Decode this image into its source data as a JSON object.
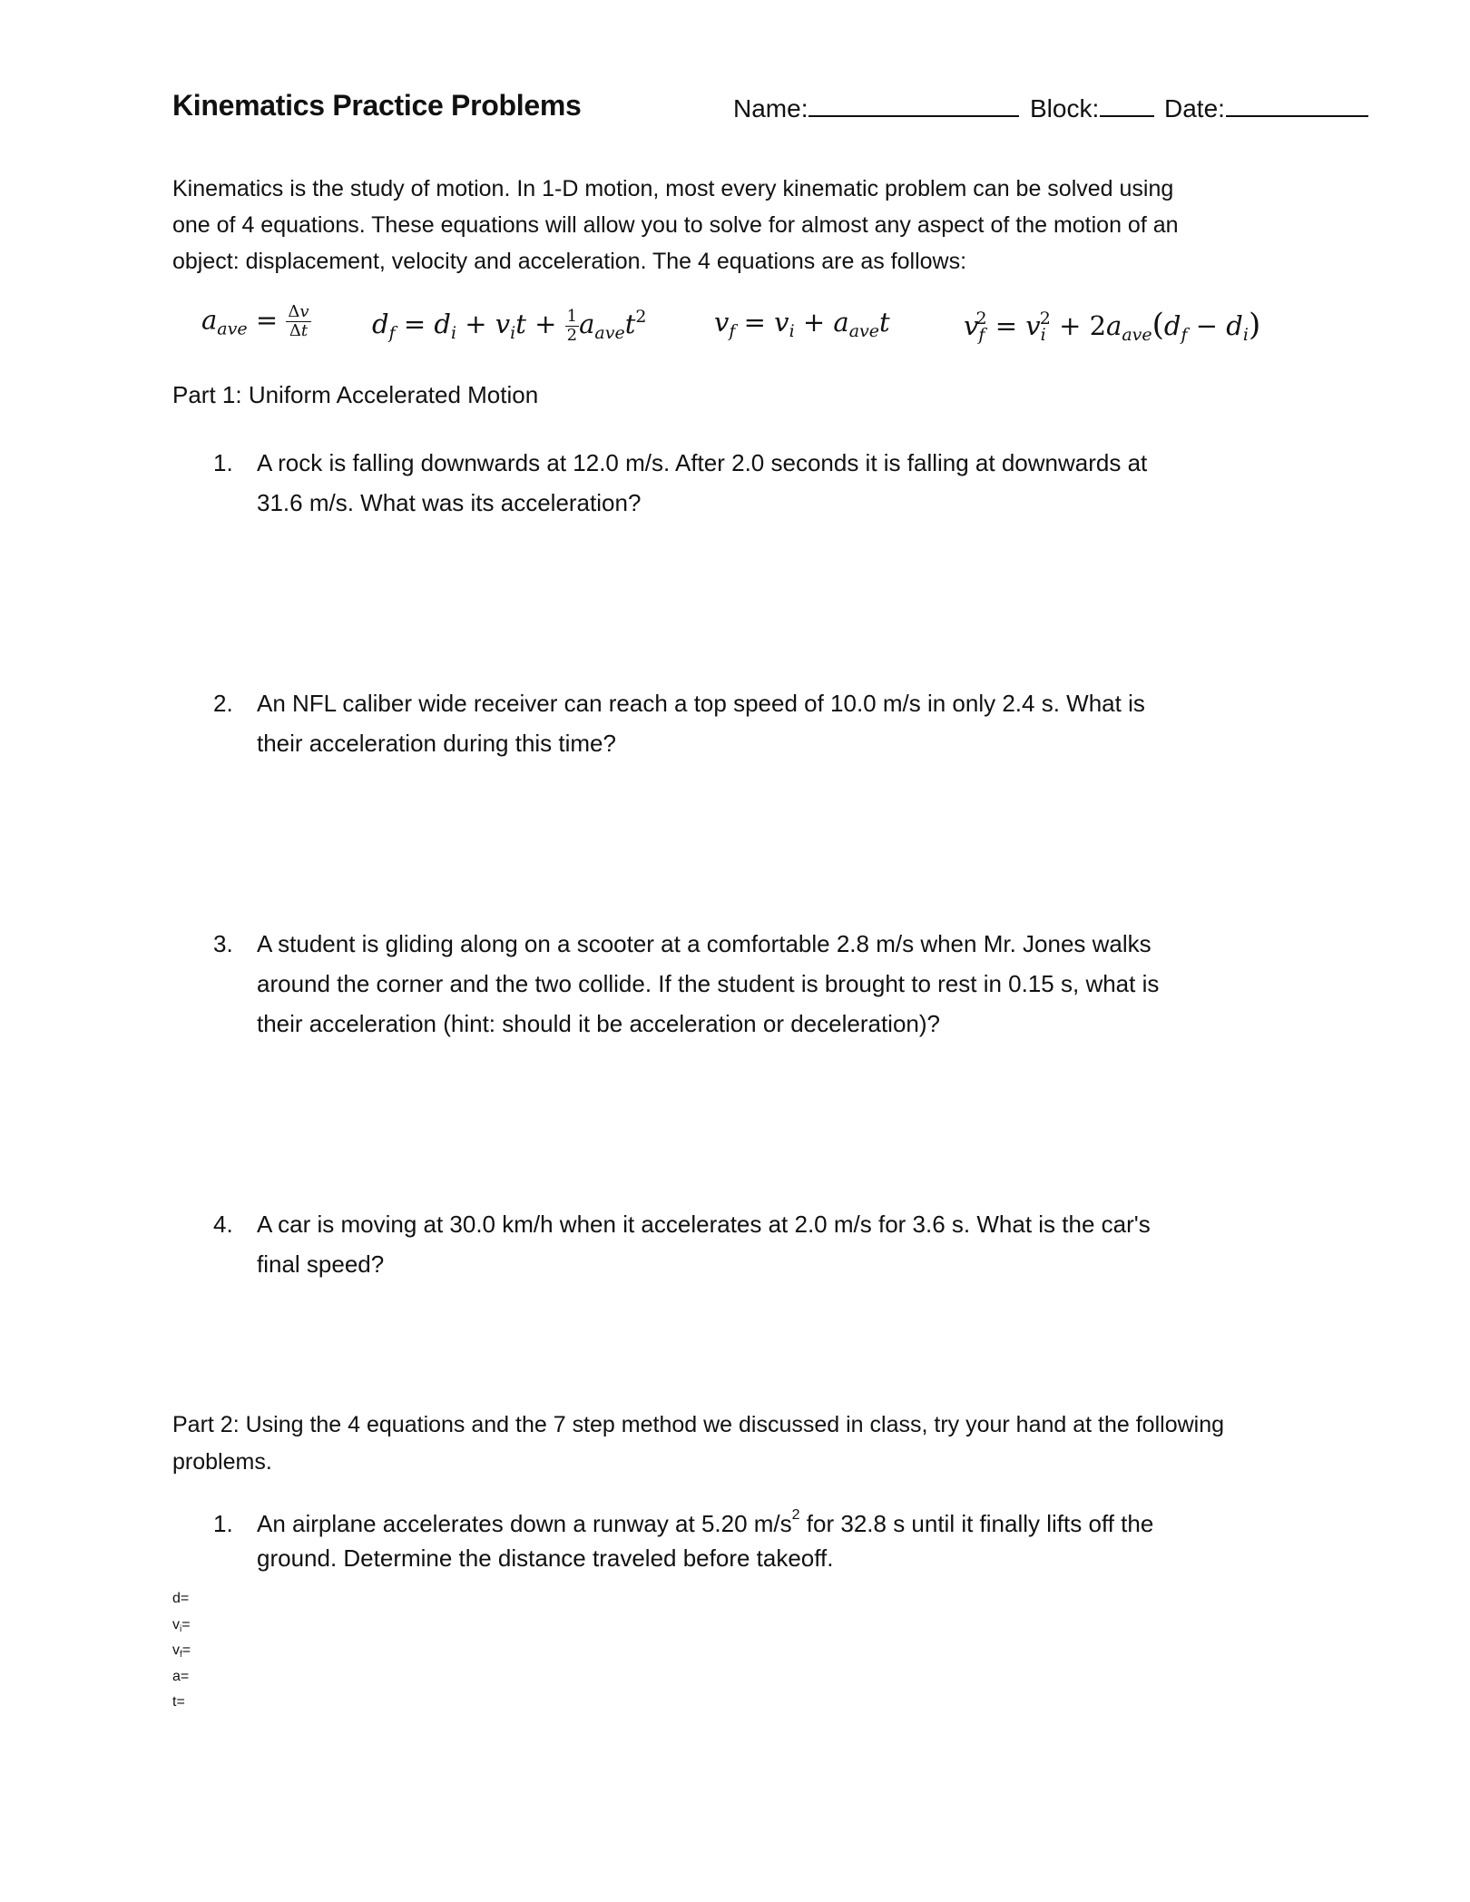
{
  "header": {
    "title": "Kinematics Practice Problems",
    "name_label": "Name:",
    "block_label": "Block:",
    "date_label": "Date:"
  },
  "intro": {
    "lines": [
      "Kinematics is the study of motion.  In 1-D motion, most every kinematic problem can be solved using",
      "one of 4 equations.  These equations will allow you to solve for almost any aspect of the motion of an",
      "object: displacement, velocity and acceleration.  The 4 equations are as follows:"
    ]
  },
  "equations": [
    {
      "id": "average-acceleration",
      "text": "a_ave = Δv / Δt"
    },
    {
      "id": "displacement",
      "text": "d_f = d_i + v_i t + ½ a_ave t²"
    },
    {
      "id": "final-velocity",
      "text": "v_f = v_i + a_ave t"
    },
    {
      "id": "velocity-squared",
      "text": "v_f² = v_i² + 2a_ave(d_f − d_i)"
    }
  ],
  "part1": {
    "heading": "Part 1: Uniform Accelerated Motion",
    "questions": [
      {
        "number": "1.",
        "lines": [
          "A rock is falling downwards at 12.0 m/s. After 2.0 seconds it is falling at downwards at",
          "31.6 m/s. What was its acceleration?"
        ]
      },
      {
        "number": "2.",
        "lines": [
          "An NFL caliber wide receiver can reach a top speed of 10.0 m/s in only 2.4 s.  What is",
          "their acceleration during this time?"
        ]
      },
      {
        "number": "3.",
        "lines": [
          "A student is gliding along on a scooter at a comfortable 2.8 m/s when Mr. Jones walks",
          "around the corner and the two collide. If the student is brought to rest in 0.15 s, what is",
          "their acceleration (hint: should it be acceleration or deceleration)?"
        ]
      },
      {
        "number": "4.",
        "lines": [
          "A car is moving at 30.0 km/h when it accelerates at 2.0 m/s for 3.6 s.  What is the car's",
          "final speed?"
        ]
      }
    ]
  },
  "part2": {
    "heading_lines": [
      "Part 2: Using the 4 equations and the 7 step method we discussed in class, try your hand at the following",
      "problems."
    ],
    "questions": [
      {
        "number": "1.",
        "line1_before": "An airplane accelerates down a runway at 5.20 m/s",
        "line1_sup": "2",
        "line1_after": " for 32.8 s until it finally lifts off the",
        "line2": "ground. Determine the distance traveled before takeoff."
      }
    ],
    "variables": [
      {
        "base": "d",
        "sub": "",
        "suffix": "="
      },
      {
        "base": "v",
        "sub": "i",
        "suffix": "="
      },
      {
        "base": "v",
        "sub": "f",
        "suffix": "="
      },
      {
        "base": "a",
        "sub": "",
        "suffix": "="
      },
      {
        "base": "t",
        "sub": "",
        "suffix": "="
      }
    ]
  }
}
